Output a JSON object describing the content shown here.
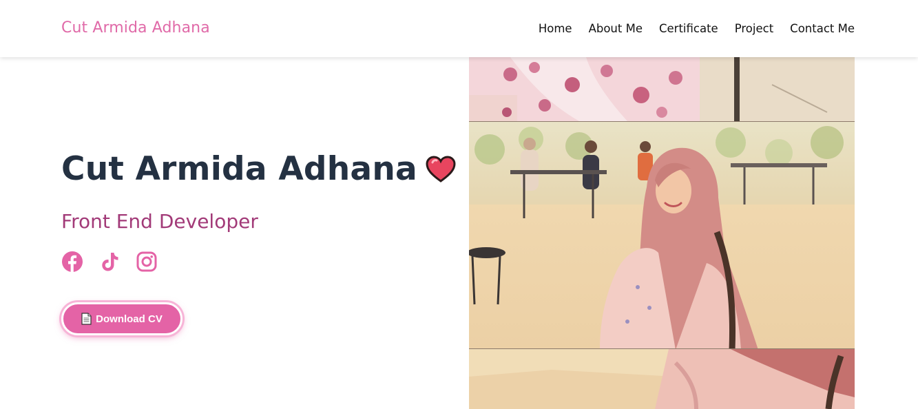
{
  "header": {
    "brand": "Cut Armida Adhana",
    "nav": [
      "Home",
      "About Me",
      "Certificate",
      "Project",
      "Contact Me"
    ]
  },
  "hero": {
    "name": "Cut Armida Adhana",
    "name_emoji": "heart-icon",
    "role": "Front End Developer",
    "socials": [
      "facebook-icon",
      "tiktok-icon",
      "instagram-icon"
    ],
    "cv_button": "Download CV",
    "cv_icon": "document-icon"
  },
  "colors": {
    "brand": "#e06aa8",
    "heading": "#243142",
    "role": "#a23a78",
    "button": "#e463a6"
  },
  "photo": {
    "description_icon": "portrait-photo"
  }
}
